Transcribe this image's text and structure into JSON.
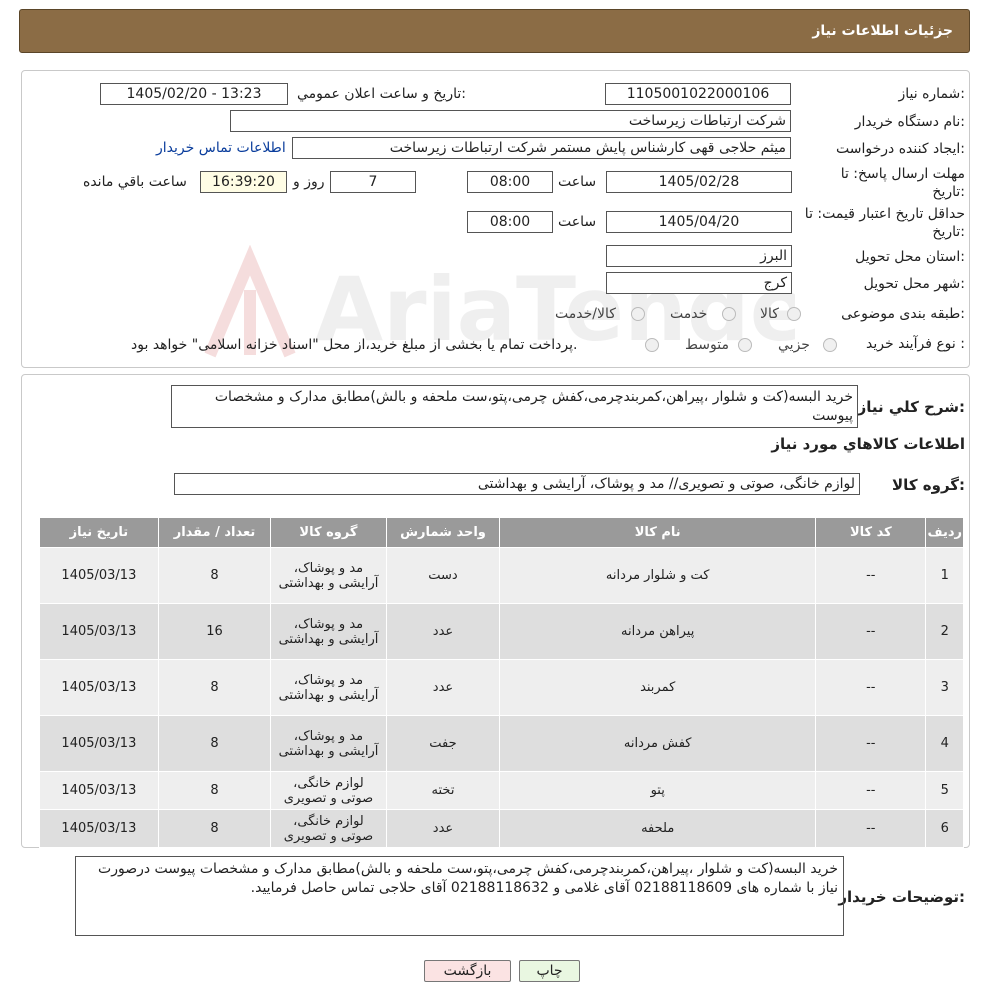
{
  "header": {
    "title": "جزئیات اطلاعات نیاز"
  },
  "form": {
    "need_number_label": "شماره نیاز:",
    "need_number": "1105001022000106",
    "announce_label": "تاریخ و ساعت اعلان عمومي:",
    "announce_value": "1405/02/20 - 13:23",
    "buyer_org_label": "نام دستگاه خریدار:",
    "buyer_org": "شرکت ارتباطات زیرساخت",
    "requester_label": "ایجاد کننده درخواست:",
    "requester": "میثم حلاجی قهی کارشناس پایش مستمر شرکت ارتباطات زیرساخت",
    "contact_link": "اطلاعات تماس خریدار",
    "deadline_label_1": "مهلت ارسال پاسخ: تا",
    "deadline_label_2": "تاریخ:",
    "deadline_date": "1405/02/28",
    "time_label": "ساعت",
    "deadline_time": "08:00",
    "days_value": "7",
    "days_label": "روز و",
    "remaining_time": "16:39:20",
    "remaining_label": "ساعت باقي مانده",
    "validity_label_1": "حداقل تاریخ اعتبار قیمت: تا",
    "validity_label_2": "تاریخ:",
    "validity_date": "1405/04/20",
    "validity_time": "08:00",
    "province_label": "استان محل تحویل:",
    "province": "البرز",
    "city_label": "شهر محل تحویل:",
    "city": "کرج",
    "category_label": "طبقه بندی موضوعی:",
    "category_options": [
      "کالا",
      "خدمت",
      "کالا/خدمت"
    ],
    "process_label": "نوع فرآیند خرید :",
    "process_options": [
      "جزیي",
      "متوسط"
    ],
    "process_note": "پرداخت تمام یا بخشی از مبلغ خرید،از محل \"اسناد خزانه اسلامی\" خواهد بود."
  },
  "summary": {
    "label": "شرح کلي نیاز:",
    "text": "خرید البسه(کت و شلوار ،پیراهن،کمربندچرمی،کفش چرمی،پتو،ست ملحفه و بالش)مطابق مدارک و مشخصات پیوست"
  },
  "goods": {
    "section_title": "اطلاعات کالاهاي مورد نیاز",
    "group_label": "گروه کالا:",
    "group_value": "لوازم خانگی، صوتی و تصویری// مد و پوشاک، آرایشی و بهداشتی",
    "columns": [
      "ردیف",
      "کد کالا",
      "نام کالا",
      "واحد شمارش",
      "گروه کالا",
      "تعداد / مقدار",
      "تاریخ نیاز"
    ],
    "rows": [
      {
        "row": "1",
        "code": "--",
        "name": "کت و شلوار مردانه",
        "unit": "دست",
        "group": "مد و پوشاک، آرایشی و بهداشتی",
        "qty": "8",
        "date": "1405/03/13"
      },
      {
        "row": "2",
        "code": "--",
        "name": "پیراهن مردانه",
        "unit": "عدد",
        "group": "مد و پوشاک، آرایشی و بهداشتی",
        "qty": "16",
        "date": "1405/03/13"
      },
      {
        "row": "3",
        "code": "--",
        "name": "کمربند",
        "unit": "عدد",
        "group": "مد و پوشاک، آرایشی و بهداشتی",
        "qty": "8",
        "date": "1405/03/13"
      },
      {
        "row": "4",
        "code": "--",
        "name": "کفش مردانه",
        "unit": "جفت",
        "group": "مد و پوشاک، آرایشی و بهداشتی",
        "qty": "8",
        "date": "1405/03/13"
      },
      {
        "row": "5",
        "code": "--",
        "name": "پتو",
        "unit": "تخته",
        "group": "لوازم خانگی، صوتی و تصویری",
        "qty": "8",
        "date": "1405/03/13"
      },
      {
        "row": "6",
        "code": "--",
        "name": "ملحفه",
        "unit": "عدد",
        "group": "لوازم خانگی، صوتی و تصویری",
        "qty": "8",
        "date": "1405/03/13"
      }
    ]
  },
  "buyer_notes": {
    "label": "توضیحات خریدار:",
    "text": "خرید البسه(کت و شلوار ،پیراهن،کمربندچرمی،کفش چرمی،پتو،ست ملحفه و بالش)مطابق مدارک و مشخصات پیوست درصورت نیاز با شماره های 02188118609 آقای غلامی و 02188118632 آقای حلاجی تماس حاصل فرمایید."
  },
  "buttons": {
    "print": "چاپ",
    "back": "بازگشت"
  },
  "watermark": {
    "text": "AriaTender.neT"
  },
  "colors": {
    "header": "#8b6c45",
    "table_header": "#9a9a9a",
    "contact_link": "#0a3d9c"
  }
}
